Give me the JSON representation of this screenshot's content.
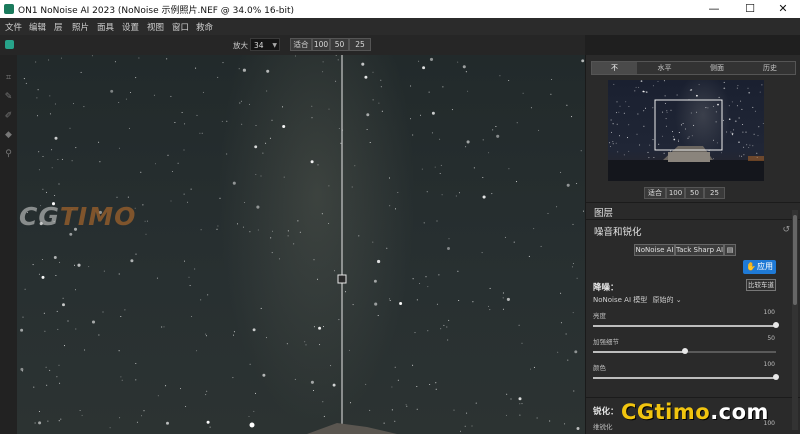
{
  "window": {
    "title": "ON1 NoNoise AI 2023 (NoNoise 示例照片.NEF @ 34.0% 16-bit)",
    "minimize": "—",
    "maximize": "☐",
    "close": "✕"
  },
  "menu": [
    "文件",
    "编辑",
    "层",
    "照片",
    "面具",
    "设置",
    "视图",
    "窗口",
    "救命"
  ],
  "toolbar": {
    "zoom_label": "放大",
    "zoom_value": "34",
    "fit_label": "适合",
    "zoom_presets": [
      "100",
      "50",
      "25"
    ]
  },
  "left_tools": [
    "crop-icon",
    "brush-icon",
    "perfect-brush-icon",
    "retouch-icon",
    "zoom-icon"
  ],
  "watermarks": {
    "left_main": "CG",
    "left_accent": "TIMO",
    "right_main": "CGtimo",
    "right_accent": ".com"
  },
  "panel": {
    "view_tabs": [
      "不",
      "水平",
      "侧面",
      "历史"
    ],
    "preview_zoom": {
      "fit_label": "适合",
      "presets": [
        "100",
        "50",
        "25"
      ]
    },
    "layers_title": "图层",
    "noise_section_title": "噪音和锐化",
    "filter_buttons": [
      "NoNoise AI",
      "Tack Sharp AI"
    ],
    "apply_label": "应用",
    "denoise_title": "降噪：",
    "compare_button": "比较车道",
    "model_label": "NoNoise AI 模型",
    "model_value": "原始的",
    "sliders": [
      {
        "label": "亮度",
        "value": 100
      },
      {
        "label": "加强细节",
        "value": 50
      },
      {
        "label": "颜色",
        "value": 100
      }
    ],
    "sharpen_title": "锐化：",
    "sharpen_slider": {
      "label": "维锐化",
      "value": 100
    }
  },
  "colors": {
    "accent_blue": "#1f7ad6",
    "panel_bg": "#2a2a2a",
    "watermark_orange": "#c8742a",
    "watermark_yellow": "#f1c40f"
  }
}
